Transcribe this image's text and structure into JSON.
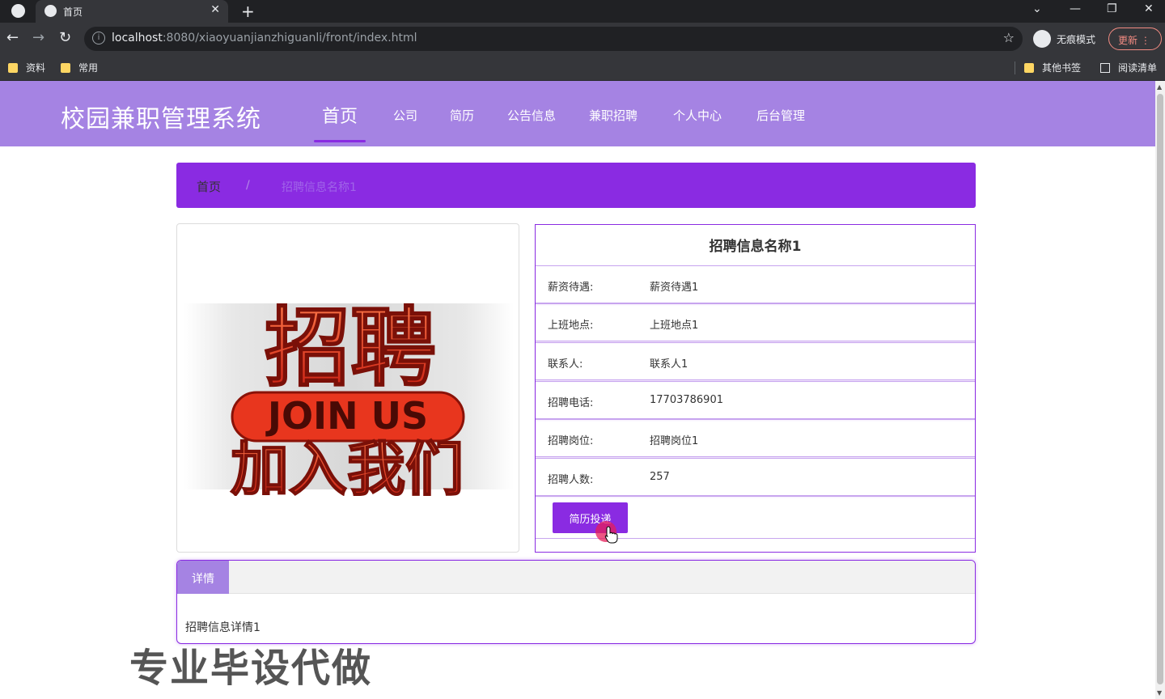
{
  "browser": {
    "tab_title": "首页",
    "url_host": "localhost",
    "url_rest": ":8080/xiaoyuanjianzhiguanli/front/index.html",
    "incognito_label": "无痕模式",
    "update_label": "更新",
    "bookmarks": [
      "资料",
      "常用"
    ],
    "other_bookmarks": "其他书签",
    "reading_list": "阅读清单"
  },
  "site": {
    "title": "校园兼职管理系统",
    "nav": [
      "首页",
      "公司",
      "简历",
      "公告信息",
      "兼职招聘",
      "个人中心",
      "后台管理"
    ],
    "accent": "#8a2be2",
    "header_bg": "#a583e3"
  },
  "breadcrumb": {
    "home": "首页",
    "separator": "/",
    "current": "招聘信息名称1"
  },
  "poster": {
    "line1": "招聘",
    "line2": "JOIN US",
    "line3": "加入我们"
  },
  "job": {
    "title": "招聘信息名称1",
    "fields": [
      {
        "label": "薪资待遇:",
        "value": "薪资待遇1"
      },
      {
        "label": "上班地点:",
        "value": "上班地点1"
      },
      {
        "label": "联系人:",
        "value": "联系人1"
      },
      {
        "label": "招聘电话:",
        "value": "17703786901"
      },
      {
        "label": "招聘岗位:",
        "value": "招聘岗位1"
      },
      {
        "label": "招聘人数:",
        "value": "257"
      }
    ],
    "apply_button": "简历投递"
  },
  "detail": {
    "tab": "详情",
    "content": "招聘信息详情1"
  },
  "watermark": "专业毕设代做"
}
